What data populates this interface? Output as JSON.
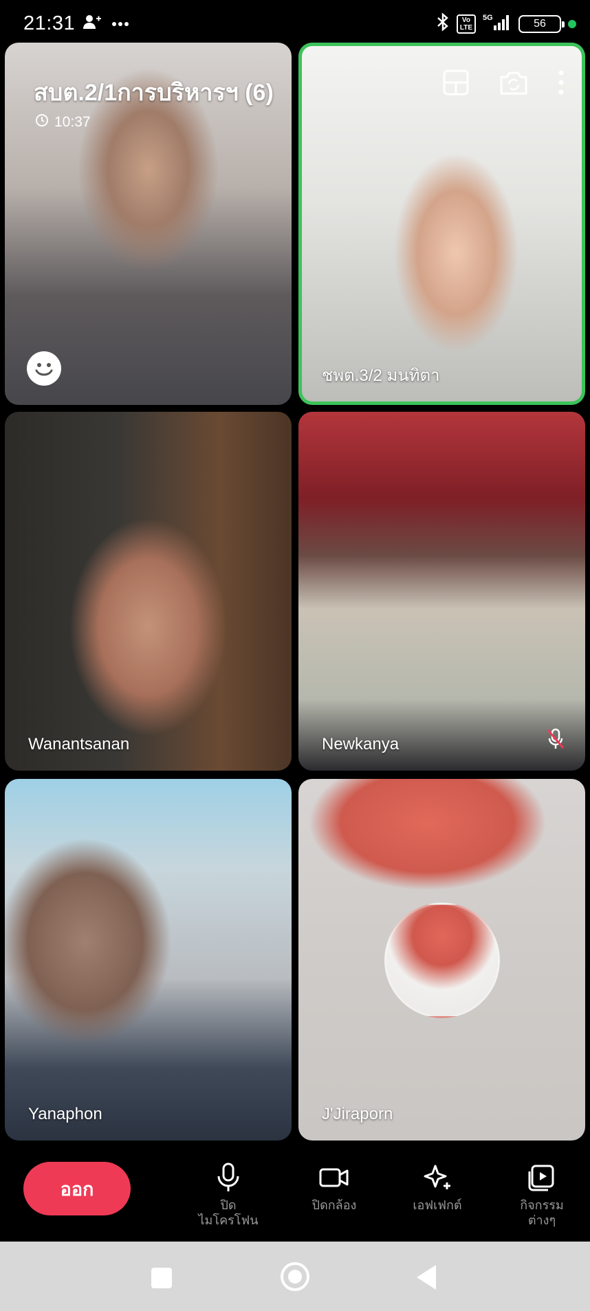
{
  "status_bar": {
    "time": "21:31",
    "battery": "56",
    "network": "5G",
    "volte": "Vo\nLTE"
  },
  "call": {
    "title": "สบต.2/1การบริหารฯ (6)",
    "timer": "10:37"
  },
  "participants": [
    {
      "name": ""
    },
    {
      "name": "ชพต.3/2 มนทิตา",
      "active": true
    },
    {
      "name": "Wanantsanan"
    },
    {
      "name": "Newkanya",
      "muted": true
    },
    {
      "name": "Yanaphon"
    },
    {
      "name": "J'Jiraporn"
    }
  ],
  "controls": {
    "leave": "ออก",
    "mic_line1": "ปิด",
    "mic_line2": "ไมโครโฟน",
    "camera": "ปิดกล้อง",
    "effects": "เอฟเฟกต์",
    "activities_line1": "กิจกรรม",
    "activities_line2": "ต่างๆ"
  },
  "colors": {
    "leave_button": "#ef3a56",
    "active_border": "#3cc35a",
    "status_dot": "#22c55e"
  }
}
